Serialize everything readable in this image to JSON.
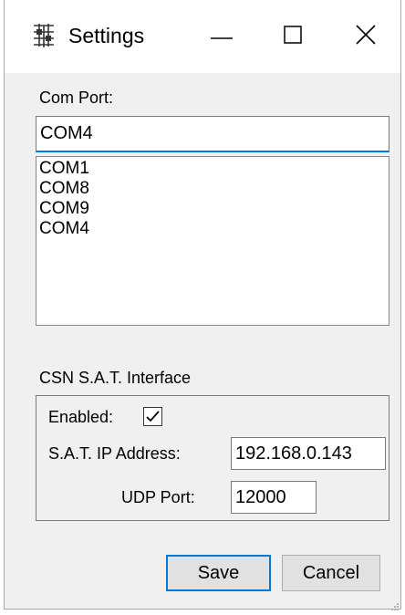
{
  "window": {
    "title": "Settings",
    "icons": {
      "app": "network-grid-icon",
      "minimize": "minimize-icon",
      "maximize": "maximize-icon",
      "close": "close-icon"
    }
  },
  "com_port": {
    "label": "Com Port:",
    "selected_value": "COM4",
    "options": [
      "COM1",
      "COM8",
      "COM9",
      "COM4"
    ]
  },
  "sat_interface": {
    "group_label": "CSN S.A.T. Interface",
    "enabled_label": "Enabled:",
    "enabled": true,
    "ip_label": "S.A.T. IP Address:",
    "ip_value": "192.168.0.143",
    "udp_label": "UDP Port:",
    "udp_value": "12000"
  },
  "actions": {
    "save_label": "Save",
    "cancel_label": "Cancel"
  },
  "colors": {
    "focus_accent": "#0078d7",
    "window_background": "#f0f0f0",
    "titlebar_background": "#ffffff"
  }
}
